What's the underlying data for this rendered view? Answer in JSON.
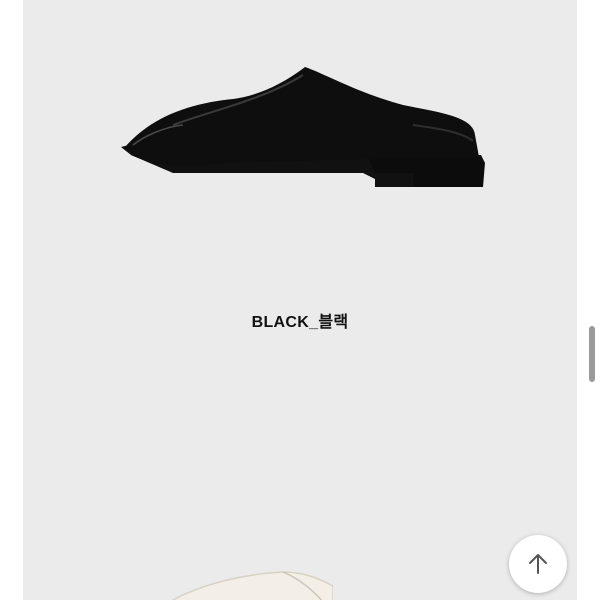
{
  "product": {
    "caption": "BLACK_블랙",
    "image_icon": "black-slip-on-mule-shoe"
  },
  "next_product": {
    "image_icon": "cream-shoe-partial"
  },
  "controls": {
    "scroll_top_icon": "arrow-up-icon"
  },
  "colors": {
    "panel_bg": "#ebebeb",
    "shoe": "#0e0e0e",
    "button_bg": "#ffffff"
  }
}
